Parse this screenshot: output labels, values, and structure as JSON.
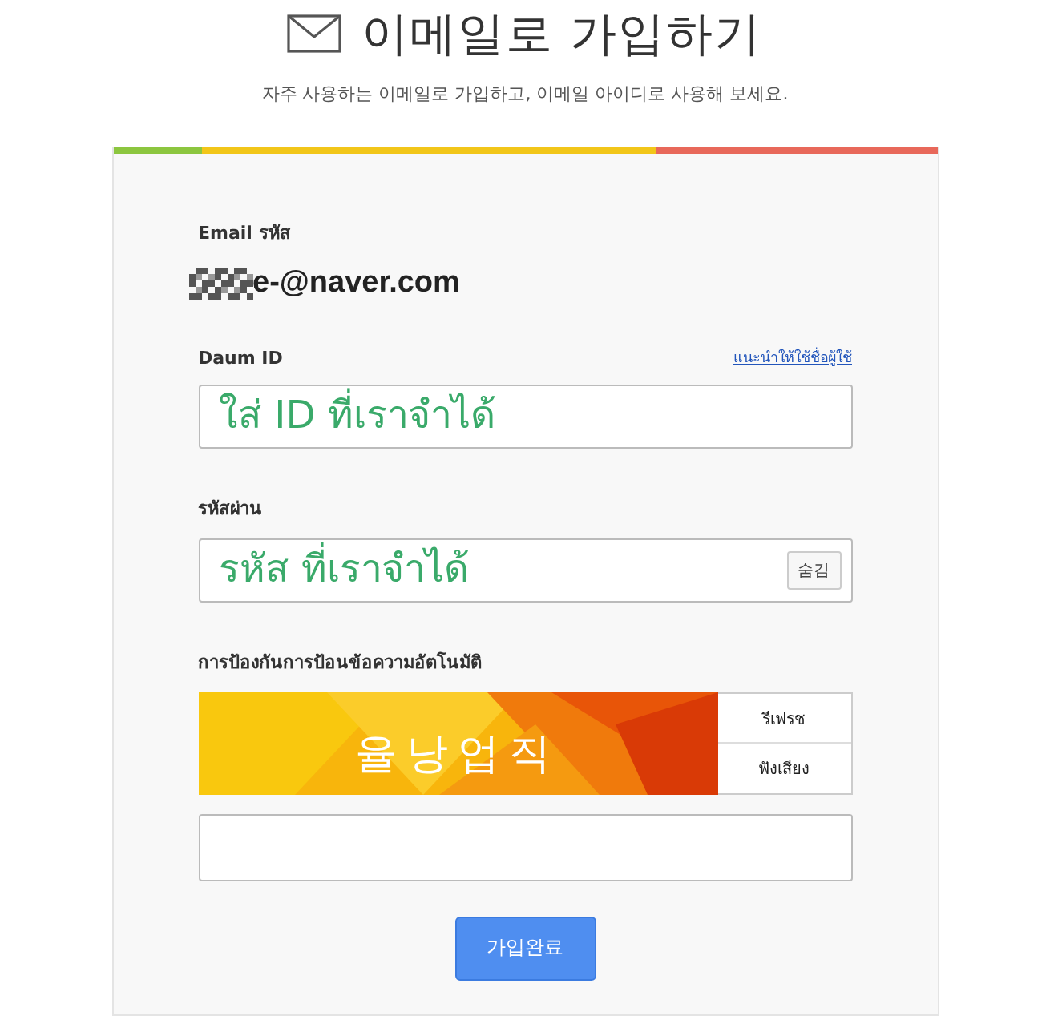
{
  "header": {
    "title": "이메일로 가입하기",
    "subtitle": "자주 사용하는 이메일로 가입하고, 이메일 아이디로 사용해 보세요."
  },
  "form": {
    "email": {
      "label": "Email รหัส",
      "value": "e-@naver.com"
    },
    "daum_id": {
      "label": "Daum ID",
      "link": "แนะนำให้ใช้ชื่อผู้ใช้",
      "value": "ใส่ ID ที่เราจำได้"
    },
    "password": {
      "label": "รหัสผ่าน",
      "value": "รหัส ที่เราจำได้",
      "toggle": "숨김"
    },
    "captcha": {
      "label": "การป้องกันการป้อนข้อความอัตโนมัติ",
      "text": "율낭업직",
      "actions": [
        "รีเฟรช",
        "ฟังเสียง"
      ]
    },
    "submit": "가입완료"
  }
}
